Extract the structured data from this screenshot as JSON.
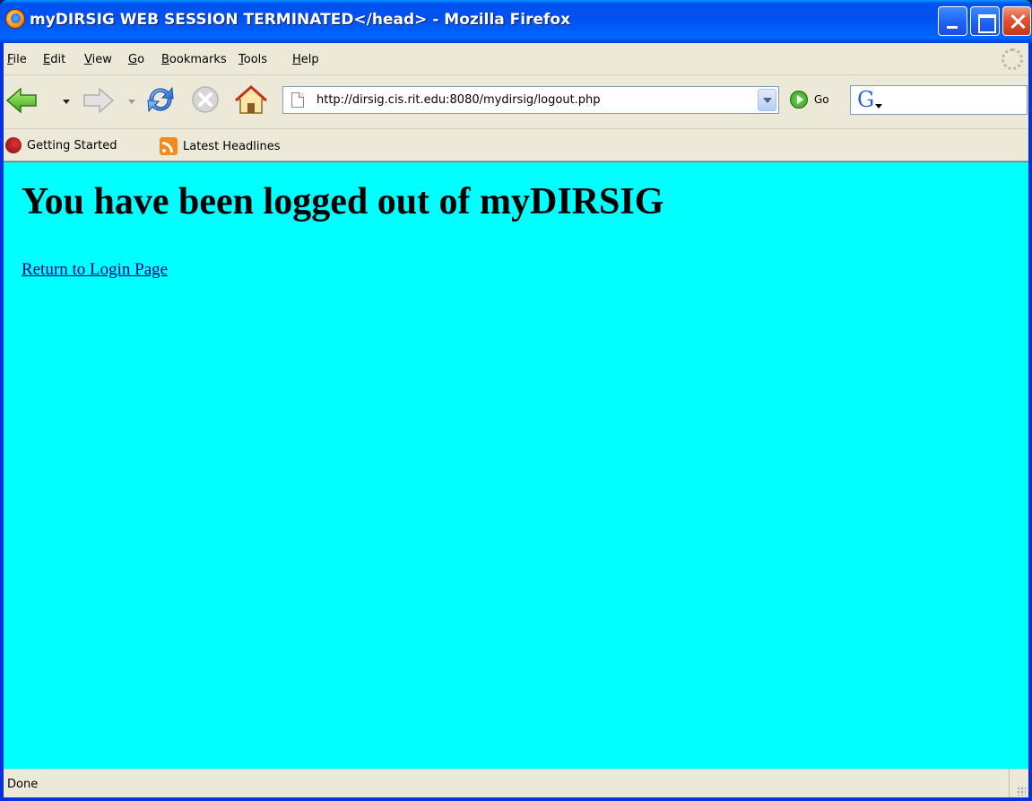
{
  "window": {
    "title": "myDIRSIG WEB SESSION TERMINATED</head> - Mozilla Firefox"
  },
  "menubar": {
    "items": [
      {
        "label": "File",
        "ul": "F",
        "rest": "ile"
      },
      {
        "label": "Edit",
        "ul": "E",
        "rest": "dit"
      },
      {
        "label": "View",
        "ul": "V",
        "rest": "iew"
      },
      {
        "label": "Go",
        "ul": "G",
        "rest": "o"
      },
      {
        "label": "Bookmarks",
        "ul": "B",
        "rest": "ookmarks"
      },
      {
        "label": "Tools",
        "ul": "T",
        "rest": "ools"
      },
      {
        "label": "Help",
        "ul": "H",
        "rest": "elp"
      }
    ]
  },
  "navbar": {
    "url": "http://dirsig.cis.rit.edu:8080/mydirsig/logout.php",
    "go_label": "Go",
    "search_value": ""
  },
  "bookmarks": {
    "getting_started": "Getting Started",
    "latest_headlines": "Latest Headlines"
  },
  "page": {
    "heading": "You have been logged out of myDIRSIG",
    "link_text": "Return to Login Page",
    "background_color": "#00ffff"
  },
  "statusbar": {
    "text": "Done"
  }
}
